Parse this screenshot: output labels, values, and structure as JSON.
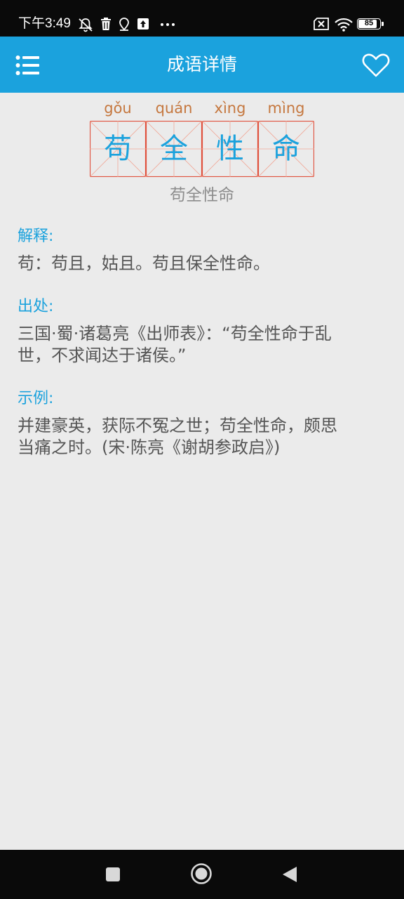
{
  "status_bar": {
    "time": "下午3:49",
    "battery": "85",
    "icons": [
      "muted-bell-icon",
      "trash-icon",
      "location-icon",
      "upload-icon",
      "more-dots-icon",
      "sim-error-icon",
      "wifi-icon",
      "battery-icon"
    ]
  },
  "app_bar": {
    "title": "成语详情",
    "menu_icon": "menu-list-icon",
    "favorite_icon": "heart-outline-icon"
  },
  "idiom": {
    "characters": [
      {
        "pinyin": "gǒu",
        "char": "苟"
      },
      {
        "pinyin": "quán",
        "char": "全"
      },
      {
        "pinyin": "xìng",
        "char": "性"
      },
      {
        "pinyin": "mìng",
        "char": "命"
      }
    ],
    "plain": "苟全性命"
  },
  "sections": {
    "explanation": {
      "label": "解释:",
      "text": "苟：苟且，姑且。苟且保全性命。"
    },
    "source": {
      "label": "出处:",
      "line1": "三国·蜀·诸葛亮《出师表》：“苟全性命于乱",
      "line2": "世，不求闻达于诸侯。”"
    },
    "example": {
      "label": "示例:",
      "line1": "并建豪英，获际不冤之世；苟全性命，颇思",
      "line2": "当痛之时。(宋·陈亮《谢胡参政启》)"
    }
  },
  "nav_bar": {
    "icons": [
      "recent-apps-icon",
      "home-icon",
      "back-icon"
    ]
  },
  "colors": {
    "accent": "#1ba2dd",
    "pinyin": "#c5773e",
    "grid_line": "#e0503c",
    "background": "#ebebeb"
  }
}
